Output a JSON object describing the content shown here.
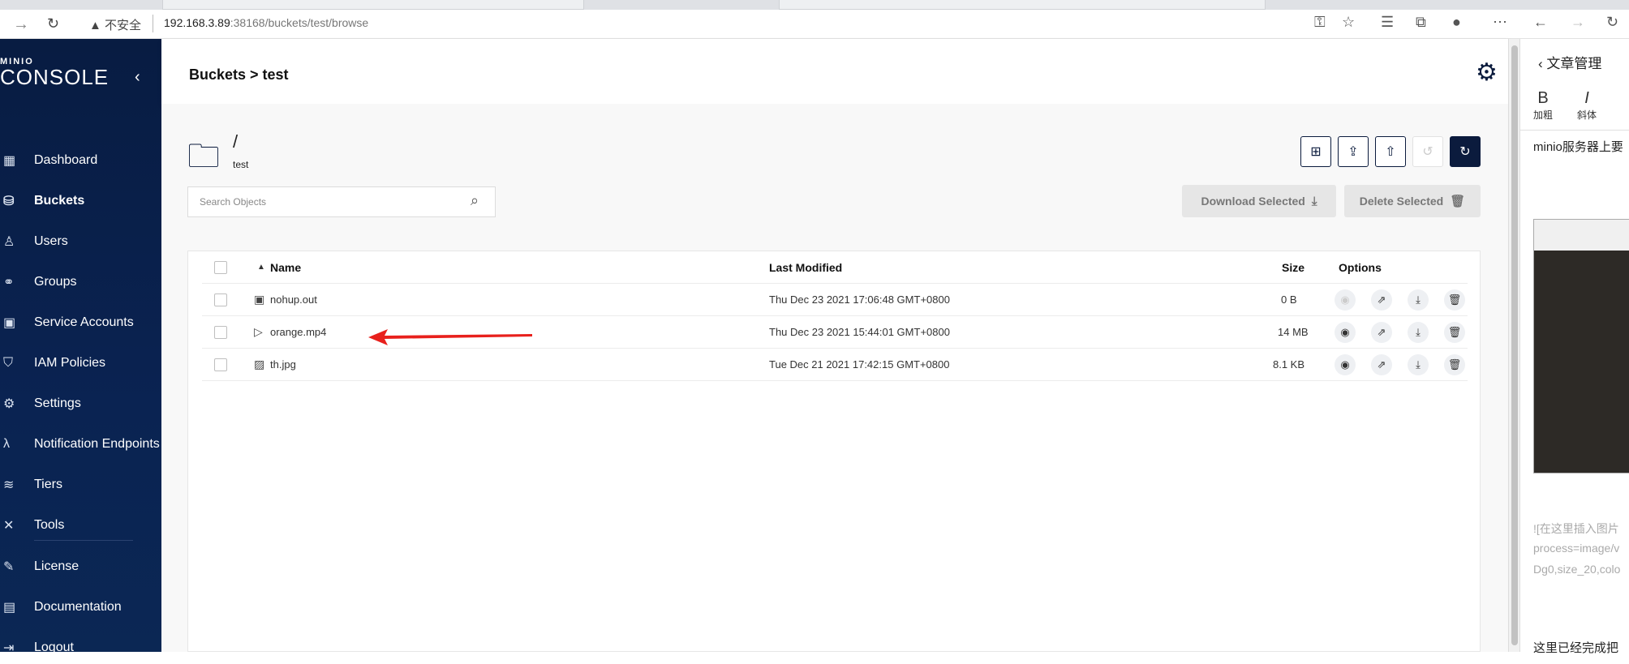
{
  "browser": {
    "security_text": "不安全",
    "url_host": "192.168.3.89",
    "url_rest": ":38168/buckets/test/browse"
  },
  "sidebar": {
    "logo_small": "MINIO",
    "logo": "CONSOLE",
    "items": [
      {
        "label": "Dashboard",
        "icon": "dashboard-icon"
      },
      {
        "label": "Buckets",
        "icon": "bucket-icon",
        "active": true
      },
      {
        "label": "Users",
        "icon": "user-icon"
      },
      {
        "label": "Groups",
        "icon": "groups-icon"
      },
      {
        "label": "Service Accounts",
        "icon": "service-accounts-icon"
      },
      {
        "label": "IAM Policies",
        "icon": "shield-icon"
      },
      {
        "label": "Settings",
        "icon": "gear-icon"
      },
      {
        "label": "Notification Endpoints",
        "icon": "lambda-icon"
      },
      {
        "label": "Tiers",
        "icon": "layers-icon"
      },
      {
        "label": "Tools",
        "icon": "tools-icon"
      },
      {
        "label": "License",
        "icon": "license-icon"
      },
      {
        "label": "Documentation",
        "icon": "documentation-icon"
      },
      {
        "label": "Logout",
        "icon": "logout-icon"
      }
    ]
  },
  "header": {
    "breadcrumb": "Buckets > test"
  },
  "browser_panel": {
    "path": "/",
    "bucket_name": "test",
    "search_placeholder": "Search Objects",
    "download_selected": "Download Selected",
    "delete_selected": "Delete Selected"
  },
  "table": {
    "columns": {
      "name": "Name",
      "last_modified": "Last Modified",
      "size": "Size",
      "options": "Options"
    },
    "rows": [
      {
        "name": "nohup.out",
        "modified": "Thu Dec 23 2021 17:06:48 GMT+0800",
        "size": "0 B",
        "icon": "file-icon"
      },
      {
        "name": "orange.mp4",
        "modified": "Thu Dec 23 2021 15:44:01 GMT+0800",
        "size": "14 MB",
        "icon": "video-file-icon"
      },
      {
        "name": "th.jpg",
        "modified": "Tue Dec 21 2021 17:42:15 GMT+0800",
        "size": "8.1 KB",
        "icon": "image-file-icon"
      }
    ]
  },
  "right_panel": {
    "title": "文章管理",
    "bold_label": "加粗",
    "italic_label": "斜体",
    "text1": "minio服务器上要",
    "gray1": "![在这里插入图片",
    "gray2": "process=image/v",
    "gray3": "Dg0,size_20,colo",
    "bottom_text": "这里已经完成把"
  },
  "colors": {
    "sidebar_bg": "#0a2352",
    "accent": "#0b1b3d",
    "annotation_arrow": "#e8201c"
  }
}
